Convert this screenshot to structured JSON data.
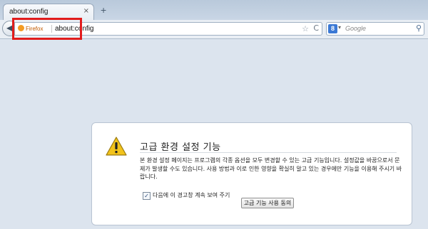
{
  "tab": {
    "title": "about:config",
    "close": "×"
  },
  "new_tab": "+",
  "nav": {
    "identity_label": "Firefox",
    "url": "about:config",
    "star": "☆",
    "reload": "C",
    "search_engine_letter": "8",
    "search_placeholder": "Google"
  },
  "dialog": {
    "title": "고급 환경 설정 기능",
    "message": "본 환경 설정 페이지는 프로그램의 각종 옵션을 모두 변경할 수 있는 고급 기능입니다. 설정값을 바꿈으로서 문제가 발생할 수도 있습니다. 사용 방법과 이로 인한 영향을 확실히 알고 있는 경우에만 기능을 이용해 주시기 바랍니다.",
    "checkbox_label": "다음에 이 경고창 계속 보여 주기",
    "checkbox_checked": true,
    "button_label": "고급 기능 사용 동의"
  },
  "colors": {
    "highlight": "#e11c1c",
    "warning": "#f2c31b"
  }
}
